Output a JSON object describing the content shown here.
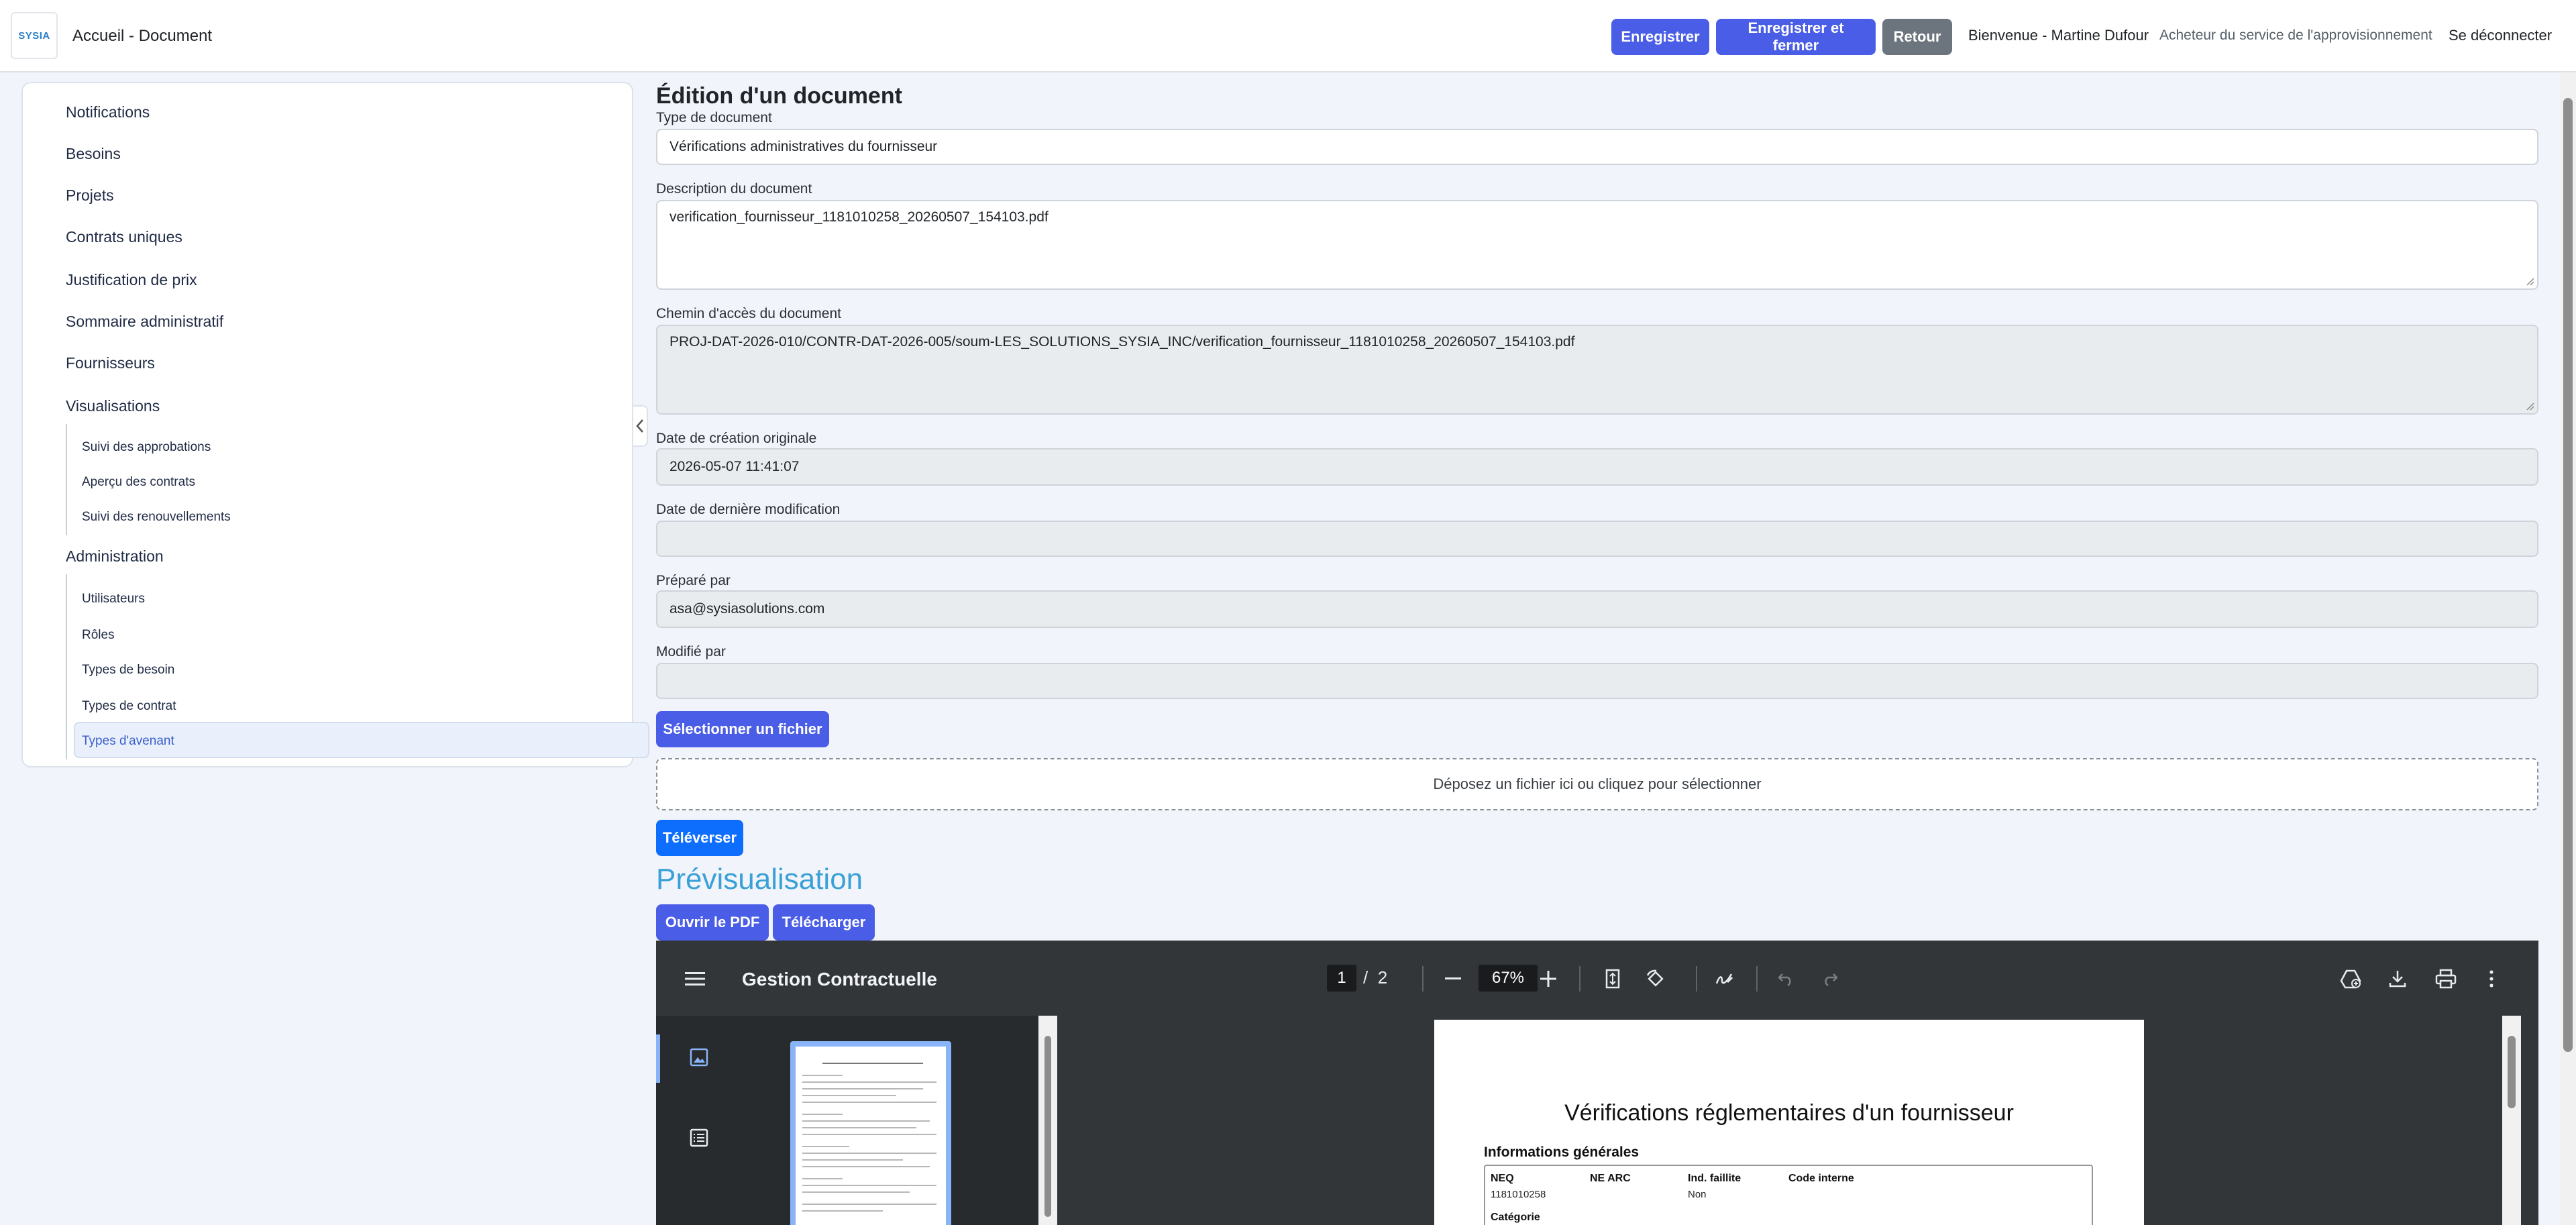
{
  "header": {
    "logo_text": "SYSIA",
    "breadcrumb": "Accueil - Document",
    "buttons": {
      "save": "Enregistrer",
      "save_close": "Enregistrer et fermer",
      "back": "Retour"
    },
    "welcome": "Bienvenue - Martine Dufour",
    "role": "Acheteur du service de l'approvisionnement",
    "logout": "Se déconnecter"
  },
  "sidebar": {
    "items": {
      "notifications": "Notifications",
      "besoins": "Besoins",
      "projets": "Projets",
      "contrats": "Contrats uniques",
      "justification": "Justification de prix",
      "sommaire": "Sommaire administratif",
      "fournisseurs": "Fournisseurs",
      "visualisations": "Visualisations",
      "administration": "Administration"
    },
    "visualisations_sub": [
      "Suivi des approbations",
      "Aperçu des contrats",
      "Suivi des renouvellements"
    ],
    "administration_sub": [
      "Utilisateurs",
      "Rôles",
      "Types de besoin",
      "Types de contrat",
      "Types d'avenant"
    ],
    "active_item": "Types d'avenant"
  },
  "form": {
    "title": "Édition d'un document",
    "type_label": "Type de document",
    "type_value": "Vérifications administratives du fournisseur",
    "description_label": "Description du document",
    "description_value": "verification_fournisseur_1181010258_20260507_154103.pdf",
    "path_label": "Chemin d'accès du document",
    "path_value": "PROJ-DAT-2026-010/CONTR-DAT-2026-005/soum-LES_SOLUTIONS_SYSIA_INC/verification_fournisseur_1181010258_20260507_154103.pdf",
    "created_label": "Date de création originale",
    "created_value": "2026-05-07 11:41:07",
    "modified_label": "Date de dernière modification",
    "modified_value": "",
    "prepared_label": "Préparé par",
    "prepared_value": "asa@sysiasolutions.com",
    "modified_by_label": "Modifié par",
    "modified_by_value": "",
    "select_file": "Sélectionner un fichier",
    "dropzone": "Déposez un fichier ici ou cliquez pour sélectionner",
    "upload": "Téléverser"
  },
  "preview": {
    "title": "Prévisualisation",
    "open_pdf": "Ouvrir le PDF",
    "download": "Télécharger"
  },
  "viewer": {
    "title": "Gestion Contractuelle",
    "current_page": "1",
    "page_sep": "/",
    "total_pages": "2",
    "zoom": "67%",
    "doc_title": "Vérifications réglementaires d'un fournisseur",
    "section_general": "Informations générales",
    "columns": [
      "NEQ",
      "NE ARC",
      "Ind. faillite",
      "Code interne"
    ],
    "neq_value": "1181010258",
    "faillite_value": "Non",
    "category_label": "Catégorie"
  },
  "icons": {
    "menu": "menu-icon",
    "zoom_out": "minus-icon",
    "zoom_in": "plus-icon",
    "fit": "fit-page-icon",
    "rotate": "rotate-icon",
    "annotate": "draw-icon",
    "undo": "undo-icon",
    "redo": "redo-icon",
    "drive": "save-to-drive-icon",
    "download": "download-icon",
    "print": "print-icon",
    "more": "more-vertical-icon",
    "thumbnails": "image-icon",
    "outline": "outline-icon",
    "collapse": "chevron-left-icon"
  },
  "colors": {
    "primary": "#4a5de6",
    "upload": "#0d6efd",
    "secondary": "#6c757d",
    "preview_title": "#3aa0d8",
    "viewer_bg": "#323639",
    "active_thumb": "#8ab4f8"
  }
}
